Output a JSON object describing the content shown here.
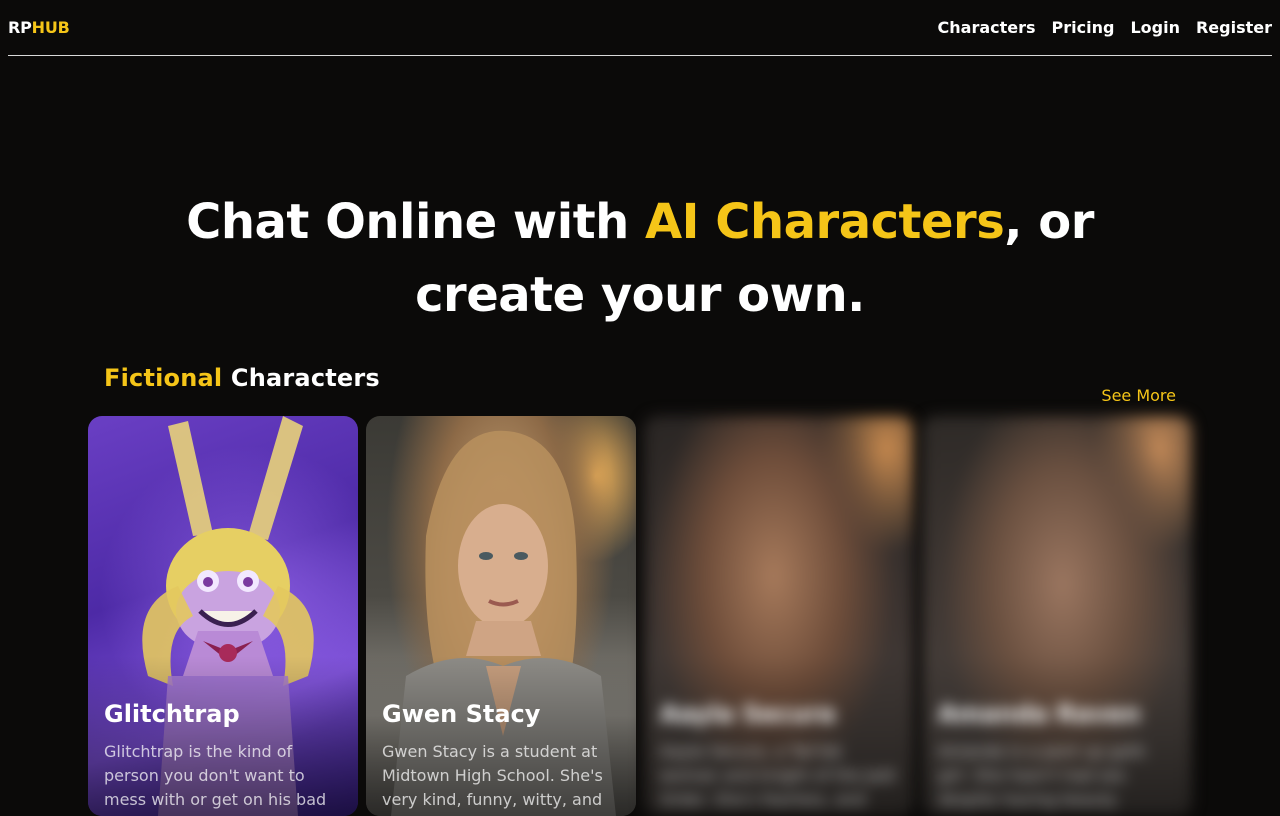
{
  "header": {
    "logo_part1": "RP",
    "logo_part2": "HUB",
    "nav": [
      "Characters",
      "Pricing",
      "Login",
      "Register"
    ]
  },
  "hero": {
    "line1_pre": "Chat Online with ",
    "line1_accent": "AI Characters",
    "line1_post": ", or",
    "line2": "create your own."
  },
  "section": {
    "title_accent": "Fictional",
    "title_rest": " Characters",
    "see_more": "See More"
  },
  "cards": [
    {
      "name": "Glitchtrap",
      "desc": "Glitchtrap is the kind of person you don't want to mess with or get on his bad side. He's"
    },
    {
      "name": "Gwen Stacy",
      "desc": "Gwen Stacy is a student at Midtown High School. She's very kind, funny, witty, and"
    },
    {
      "name": "Aayla Secura",
      "desc": "Aayla Secura, a Twi'lek woman and knight of the Jedi Order. She's fearless, and"
    },
    {
      "name": "Amanda Raven",
      "desc": "Amanda is a pent up goth girl. She hasn't had sex despite having beauty outside. She"
    }
  ],
  "colors": {
    "accent": "#f5c518",
    "background": "#0b0a09"
  }
}
